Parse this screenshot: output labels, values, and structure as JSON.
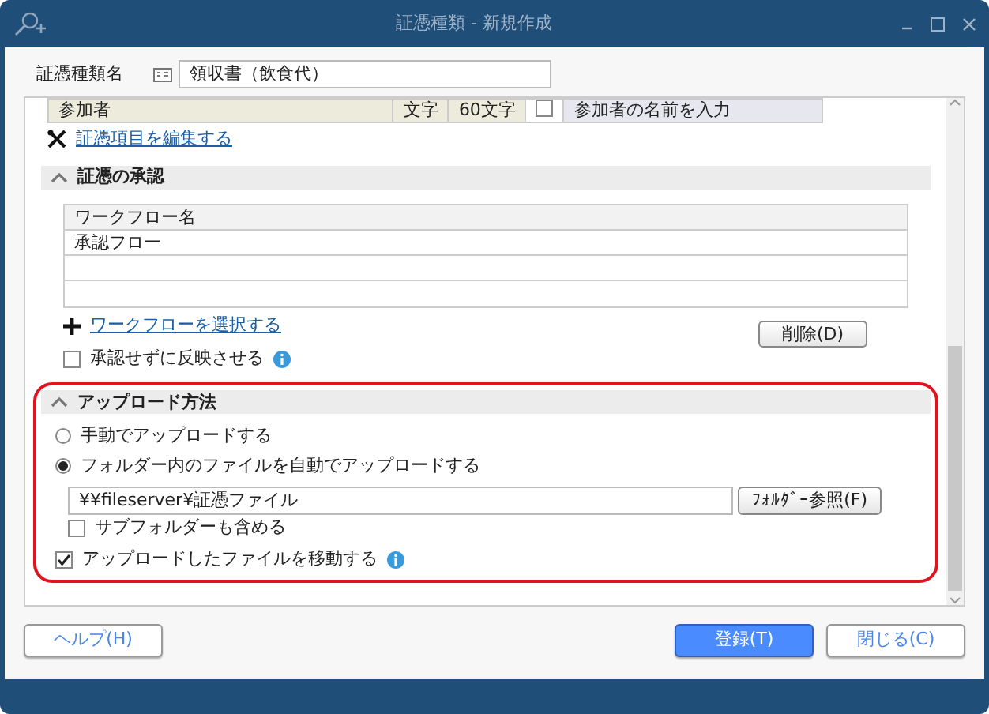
{
  "window": {
    "title": "証憑種類 - 新規作成"
  },
  "name_field": {
    "label": "証憑種類名",
    "value": "領収書（飲食代）"
  },
  "fields_table": {
    "rows": [
      {
        "name": "参加者",
        "type": "文字",
        "length": "60文字",
        "required": false,
        "description": "参加者の名前を入力"
      }
    ]
  },
  "edit_link": "証憑項目を編集する",
  "approval": {
    "title": "証憑の承認",
    "expanded": true,
    "columns": [
      "ワークフロー名"
    ],
    "rows": [
      "承認フロー"
    ],
    "select_link": "ワークフローを選択する",
    "delete_button": "削除(D)",
    "skip_checkbox": {
      "label": "承認せずに反映させる",
      "checked": false
    }
  },
  "upload": {
    "title": "アップロード方法",
    "expanded": true,
    "options": [
      {
        "label": "手動でアップロードする",
        "selected": false
      },
      {
        "label": "フォルダー内のファイルを自動でアップロードする",
        "selected": true
      }
    ],
    "folder": "¥¥fileserver¥証憑ファイル",
    "browse_button": "ﾌｫﾙﾀﾞｰ参照(F)",
    "subfolder": {
      "label": "サブフォルダーも含める",
      "checked": false
    },
    "move": {
      "label": "アップロードしたファイルを移動する",
      "checked": true
    }
  },
  "buttons": {
    "help": "ヘルプ(H)",
    "register": "登録(T)",
    "close": "閉じる(C)"
  }
}
